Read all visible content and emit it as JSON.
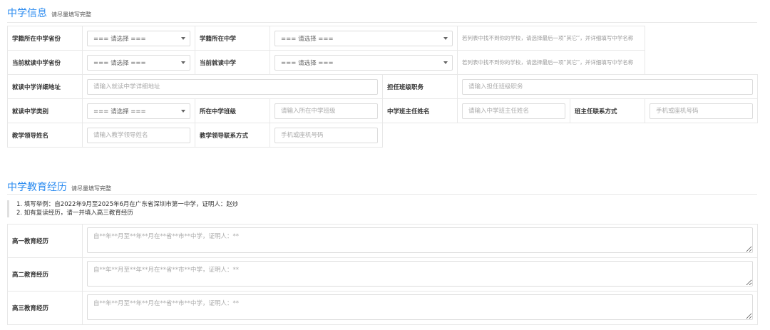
{
  "school_info": {
    "title": "中学信息",
    "hint": "请尽量填写完整",
    "select_placeholder": "=== 请选择 ===",
    "note": "若列表中找不到你的学校，请选择最后一项“其它”，并详细填写中学名称",
    "labels": {
      "registry_province": "学籍所在中学省份",
      "registry_school": "学籍所在中学",
      "current_province": "当前就读中学省份",
      "current_school": "当前就读中学",
      "detail_address": "就读中学详细地址",
      "class_position": "担任班级职务",
      "school_type": "就读中学类别",
      "class": "所在中学班级",
      "head_teacher": "中学班主任姓名",
      "head_teacher_contact": "班主任联系方式",
      "edu_leader": "教学领导姓名",
      "edu_leader_contact": "教学领导联系方式"
    },
    "placeholders": {
      "detail_address": "请输入就读中学详细地址",
      "class_position": "请输入担任班级职务",
      "class": "请输入所在中学班级",
      "head_teacher": "请输入中学班主任姓名",
      "head_teacher_contact": "手机或座机号码",
      "edu_leader": "请输入教学领导姓名",
      "edu_leader_contact": "手机或座机号码"
    }
  },
  "education": {
    "title": "中学教育经历",
    "hint": "请尽量填写完整",
    "notes": [
      "1. 填写举例：自2022年9月至2025年6月在广东省深圳市第一中学，证明人：赵炒",
      "2. 如有复读经历，请一并填入高三教育经历"
    ],
    "rows": [
      {
        "label": "高一教育经历",
        "placeholder": "自**年**月至**年**月在**省**市**中学，证明人：**"
      },
      {
        "label": "高二教育经历",
        "placeholder": "自**年**月至**年**月在**省**市**中学，证明人：**"
      },
      {
        "label": "高三教育经历",
        "placeholder": "自**年**月至**年**月在**省**市**中学，证明人：**"
      }
    ]
  }
}
